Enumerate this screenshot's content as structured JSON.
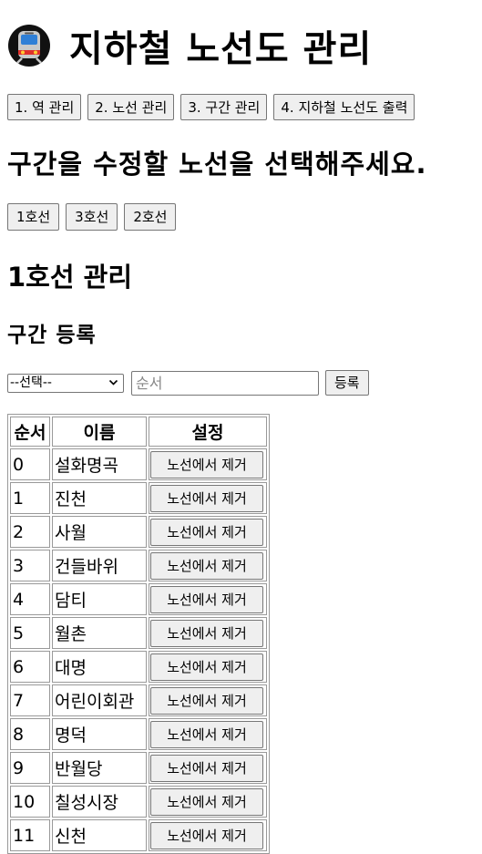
{
  "title": "지하철 노선도 관리",
  "menu": [
    {
      "label": "1. 역 관리"
    },
    {
      "label": "2. 노선 관리"
    },
    {
      "label": "3. 구간 관리"
    },
    {
      "label": "4. 지하철 노선도 출력"
    }
  ],
  "select_line_heading": "구간을 수정할 노선을 선택해주세요.",
  "lines": [
    {
      "label": "1호선"
    },
    {
      "label": "3호선"
    },
    {
      "label": "2호선"
    }
  ],
  "manage_heading": "1호선 관리",
  "section_heading": "구간 등록",
  "form": {
    "select_value": "--선택--",
    "order_placeholder": "순서",
    "register_label": "등록"
  },
  "table": {
    "headers": [
      "순서",
      "이름",
      "설정"
    ],
    "remove_label": "노선에서 제거",
    "rows": [
      {
        "order": "0",
        "name": "설화명곡"
      },
      {
        "order": "1",
        "name": "진천"
      },
      {
        "order": "2",
        "name": "사월"
      },
      {
        "order": "3",
        "name": "건들바위"
      },
      {
        "order": "4",
        "name": "담티"
      },
      {
        "order": "5",
        "name": "월촌"
      },
      {
        "order": "6",
        "name": "대명"
      },
      {
        "order": "7",
        "name": "어린이회관"
      },
      {
        "order": "8",
        "name": "명덕"
      },
      {
        "order": "9",
        "name": "반월당"
      },
      {
        "order": "10",
        "name": "칠성시장"
      },
      {
        "order": "11",
        "name": "신천"
      }
    ]
  }
}
